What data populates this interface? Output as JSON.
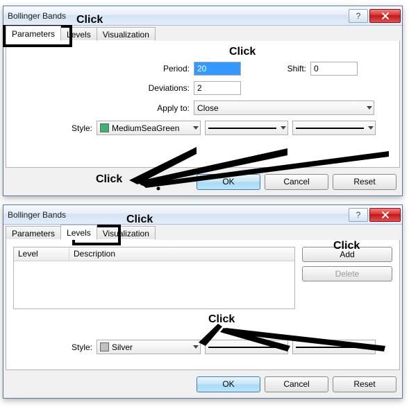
{
  "dialog1": {
    "title": "Bollinger Bands",
    "help": "?",
    "tabs": {
      "parameters": "Parameters",
      "levels": "Levels",
      "visualization": "Visualization"
    },
    "labels": {
      "period": "Period:",
      "shift": "Shift:",
      "deviations": "Deviations:",
      "apply_to": "Apply to:",
      "style": "Style:"
    },
    "values": {
      "period": "20",
      "shift": "0",
      "deviations": "2",
      "apply_to": "Close",
      "color_name": "MediumSeaGreen",
      "color_hex": "#3cb371"
    },
    "buttons": {
      "ok": "OK",
      "cancel": "Cancel",
      "reset": "Reset"
    }
  },
  "dialog2": {
    "title": "Bollinger Bands",
    "help": "?",
    "tabs": {
      "parameters": "Parameters",
      "levels": "Levels",
      "visualization": "Visualization"
    },
    "columns": {
      "level": "Level",
      "description": "Description"
    },
    "side_buttons": {
      "add": "Add",
      "delete": "Delete"
    },
    "labels": {
      "style": "Style:"
    },
    "values": {
      "color_name": "Silver",
      "color_hex": "#c0c0c0"
    },
    "buttons": {
      "ok": "OK",
      "cancel": "Cancel",
      "reset": "Reset"
    }
  },
  "annotations": {
    "click": "Click"
  }
}
